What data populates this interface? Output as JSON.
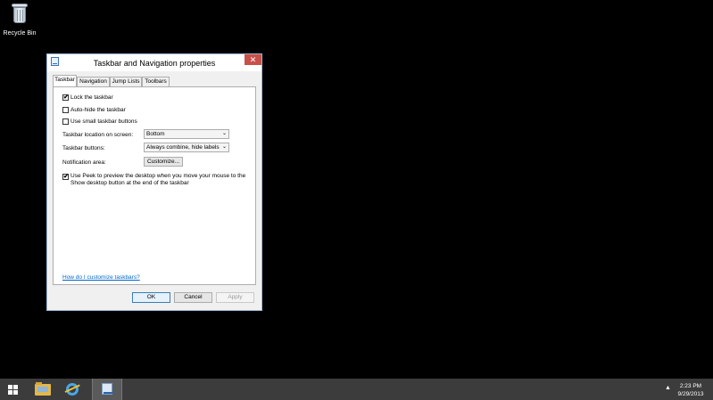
{
  "desktop": {
    "icons": [
      {
        "label": "Recycle Bin",
        "icon": "recycle-bin-icon"
      }
    ]
  },
  "dialog": {
    "title": "Taskbar and Navigation properties",
    "close_symbol": "✕",
    "tabs": [
      {
        "label": "Taskbar",
        "active": true
      },
      {
        "label": "Navigation",
        "active": false
      },
      {
        "label": "Jump Lists",
        "active": false
      },
      {
        "label": "Toolbars",
        "active": false
      }
    ],
    "checkboxes": [
      {
        "label": "Lock the taskbar",
        "checked": true
      },
      {
        "label": "Auto-hide the taskbar",
        "checked": false
      },
      {
        "label": "Use small taskbar buttons",
        "checked": false
      }
    ],
    "location_label": "Taskbar location on screen:",
    "location_value": "Bottom",
    "buttons_label": "Taskbar buttons:",
    "buttons_value": "Always combine, hide labels",
    "notification_label": "Notification area:",
    "customize_label": "Customize...",
    "peek_label": "Use Peek to preview the desktop when you move your mouse to the Show desktop button at the end of the taskbar",
    "peek_checked": true,
    "check_mark": "✔",
    "chevron": "⌄",
    "help_link": "How do I customize taskbars?",
    "ok_label": "OK",
    "cancel_label": "Cancel",
    "apply_label": "Apply"
  },
  "taskbar": {
    "items": [
      "start-icon",
      "file-explorer-icon",
      "internet-explorer-icon",
      "taskbar-properties-icon"
    ],
    "tray_arrow": "▲",
    "time": "2:23 PM",
    "date": "9/29/2013"
  }
}
